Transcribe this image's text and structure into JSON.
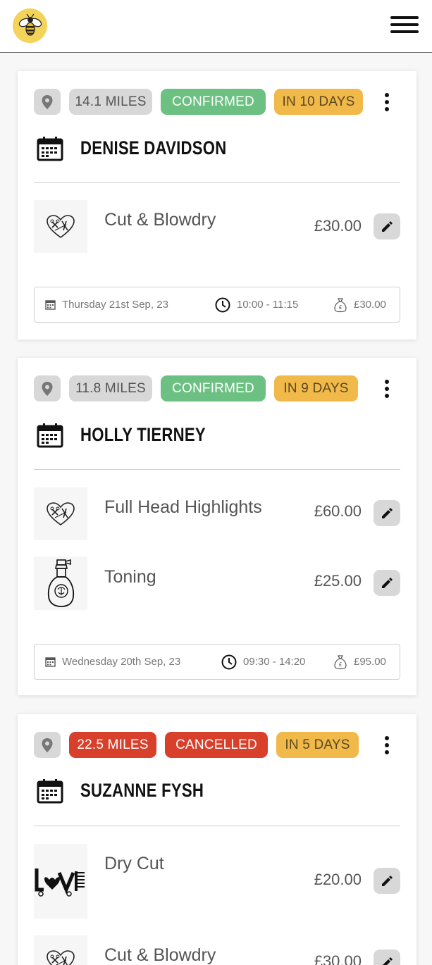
{
  "header": {
    "logo_icon": "bee-icon",
    "menu_icon": "hamburger-menu-icon"
  },
  "colors": {
    "confirmed": "#6cc082",
    "cancelled": "#d8402c",
    "days": "#f1b84a",
    "distance": "#d8d8d8",
    "brand": "#f3d35a"
  },
  "bookings": [
    {
      "distance": "14.1 MILES",
      "distance_style": "grey",
      "status": "CONFIRMED",
      "status_style": "green",
      "due": "IN 10 DAYS",
      "client": "DENISE DAVIDSON",
      "services": [
        {
          "name": "Cut & Blowdry",
          "price": "£30.00",
          "icon": "heart-scissors-icon"
        }
      ],
      "summary": {
        "date": "Thursday 21st Sep, 23",
        "time": "10:00 - 11:15",
        "total": "£30.00"
      }
    },
    {
      "distance": "11.8 MILES",
      "distance_style": "grey",
      "status": "CONFIRMED",
      "status_style": "green",
      "due": "IN 9 DAYS",
      "client": "HOLLY TIERNEY",
      "services": [
        {
          "name": "Full Head Highlights",
          "price": "£60.00",
          "icon": "heart-scissors-icon"
        },
        {
          "name": "Toning",
          "price": "£25.00",
          "icon": "spray-bottle-icon"
        }
      ],
      "summary": {
        "date": "Wednesday 20th Sep, 23",
        "time": "09:30 - 14:20",
        "total": "£95.00"
      }
    },
    {
      "distance": "22.5 MILES",
      "distance_style": "red",
      "status": "CANCELLED",
      "status_style": "red",
      "due": "IN 5 DAYS",
      "client": "SUZANNE FYSH",
      "services": [
        {
          "name": "Dry Cut",
          "price": "£20.00",
          "icon": "love-scissors-icon"
        },
        {
          "name": "Cut & Blowdry",
          "price": "£30.00",
          "icon": "heart-scissors-icon"
        }
      ]
    }
  ]
}
